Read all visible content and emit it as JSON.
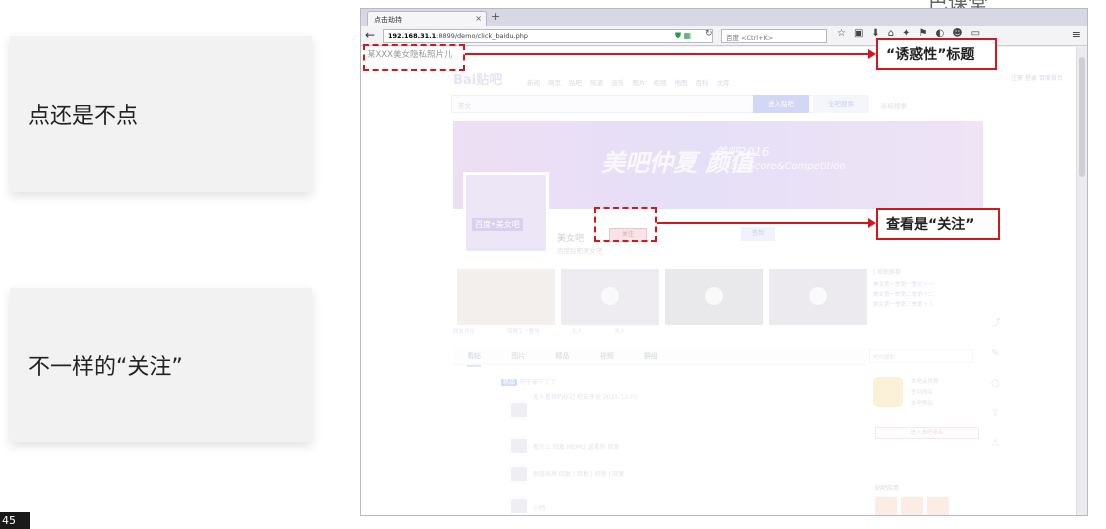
{
  "slide": {
    "card1_text": "点还是不点",
    "card2_text": "不一样的“关注”",
    "page_number": "45",
    "top_logo": "巴课堂"
  },
  "browser": {
    "tab_title": "点击劫持",
    "tab_close": "×",
    "new_tab": "+",
    "url_host": "192.168.31.1",
    "url_path": ":8899/demo/click_baidu.php",
    "search_placeholder": "百度 <Ctrl+K>",
    "page_title_text": "某XXX美女隐私照片儿"
  },
  "baidu_page": {
    "logo": "Bai贴吧",
    "nav": "新闻 网页 贴吧 知道 音乐 图片 视频 地图 百科 文库",
    "search_placeholder": "美女",
    "enter_bar_button": "进入贴吧",
    "search_all_button": "全吧搜索",
    "advanced_search": "高级搜索",
    "top_links": "注册 登录 百度首页",
    "banner_title": "美吧仲夏 颜值",
    "banner_sub1": "美吧2016",
    "banner_sub2": "FaceScore&Competition",
    "avatar_label": "百度•美女吧",
    "bar_name": "美女吧",
    "bar_sub": "百度贴吧美女吧",
    "follow_btn": "关注",
    "sign_btn": "签到",
    "thumb_captions": "网友评论 惊艳了一整年 无人 无人",
    "side_title": "| 美图推荐",
    "side_lines": [
      "美女第一季第一季的十一",
      "美女第一季第二季第十二",
      "美女第一季第三季第十三"
    ],
    "tabs": [
      "看帖",
      "图片",
      "精品",
      "视频",
      "群组"
    ],
    "search_in_bar": "吧内搜索",
    "threads": [
      {
        "badge": "精品",
        "text": "吧子被干了了"
      },
      {
        "badge": "",
        "text": "无人看待的标记   吧友评论 2023-12-01"
      },
      {
        "badge": "",
        "text": "看什么 回复 MEMO 温柔的 回复"
      },
      {
        "badge": "",
        "text": "颜值很高 回复 | 回复 | 回复 | 回复"
      },
      {
        "badge": "",
        "text": "小吧"
      }
    ],
    "rank_lines": [
      "本吧会员数",
      "签到排名",
      "本吧等级"
    ],
    "rank_btn": "进入本吧排名",
    "feat_title": "贴吧应用"
  },
  "annotations": {
    "callout_title": "“诱惑性”标题",
    "callout_follow": "查看是“关注”"
  },
  "colors": {
    "annotation_red": "#d6161d",
    "baidu_blue": "#9aa8e8"
  }
}
